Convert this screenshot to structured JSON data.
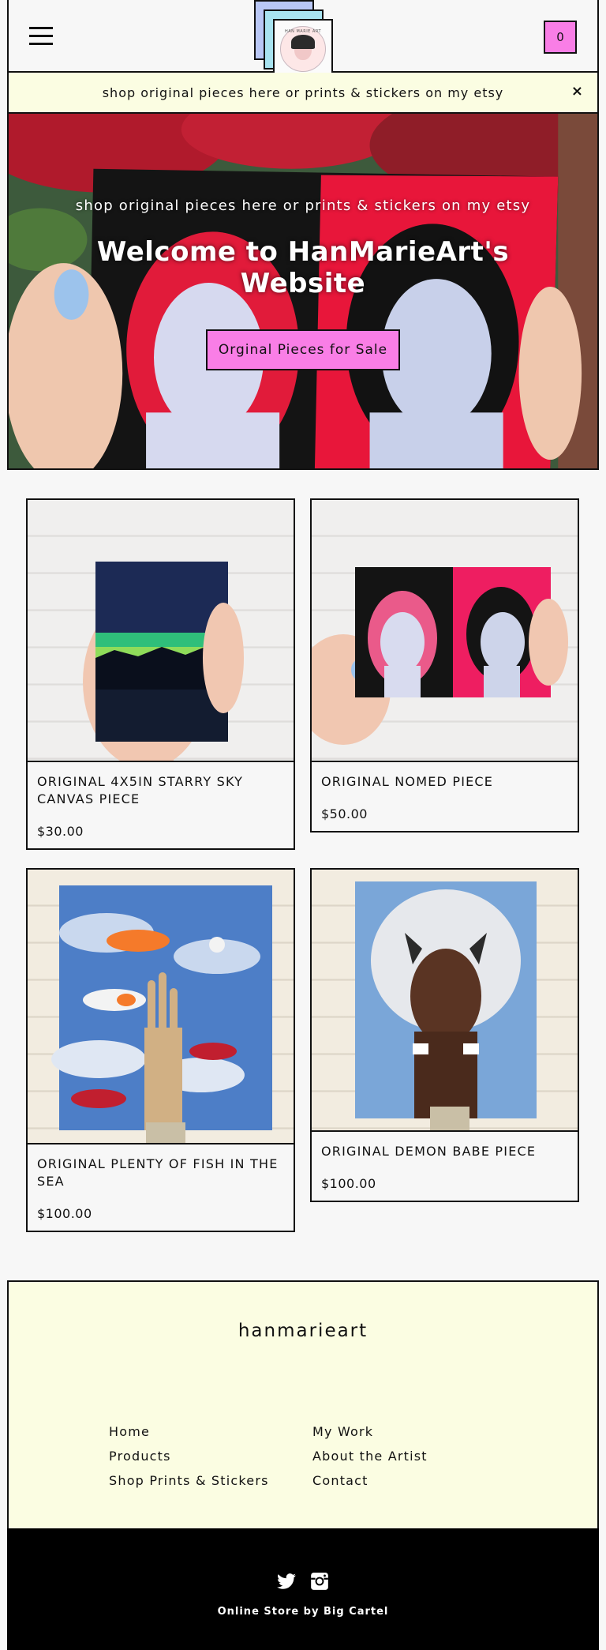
{
  "header": {
    "menu_icon": "hamburger-menu-icon",
    "logo_text": "HAN MARIE ART",
    "cart_count": "0"
  },
  "announcement": {
    "text": "shop original pieces here or prints & stickers on my etsy",
    "close": "×"
  },
  "hero": {
    "subtitle": "shop original pieces here or prints & stickers on my etsy",
    "title": "Welcome to HanMarieArt's Website",
    "cta_label": "Orginal Pieces for Sale"
  },
  "products": [
    {
      "name": "ORIGINAL 4X5IN STARRY SKY CANVAS PIECE",
      "price": "$30.00"
    },
    {
      "name": "ORIGINAL NOMED PIECE",
      "price": "$50.00"
    },
    {
      "name": "ORIGINAL PLENTY OF FISH IN THE SEA",
      "price": "$100.00"
    },
    {
      "name": "ORIGINAL DEMON BABE PIECE",
      "price": "$100.00"
    }
  ],
  "footer": {
    "brand": "hanmarieart",
    "links_left": [
      "Home",
      "Products",
      "Shop Prints & Stickers"
    ],
    "links_right": [
      "My Work",
      "About the Artist",
      "Contact"
    ],
    "social": [
      "twitter-icon",
      "instagram-icon"
    ],
    "credit": "Online Store by Big Cartel"
  },
  "colors": {
    "accent_pink": "#f97ee6",
    "cream": "#fbfde2",
    "background": "#f7f7f7"
  }
}
